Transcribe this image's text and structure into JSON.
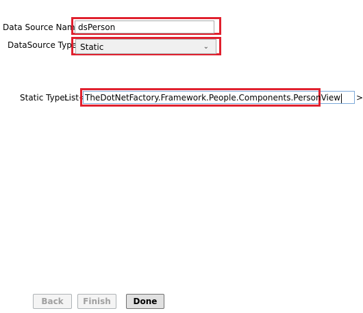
{
  "form": {
    "data_source_name_label": "Data Source Name:",
    "data_source_name_value": "dsPerson",
    "data_source_type_label": "DataSource Type:",
    "data_source_type_value": "Static",
    "static_type_label": "Static Type:",
    "list_prefix": "List<",
    "static_type_value": "TheDotNetFactory.Framework.People.Components.PersonView",
    "list_suffix": ">"
  },
  "buttons": {
    "back": "Back",
    "finish": "Finish",
    "done": "Done"
  },
  "icons": {
    "dropdown": "chevron-down-icon"
  },
  "colors": {
    "highlight": "#e0202e",
    "disabled_text": "#a0a0a0"
  }
}
